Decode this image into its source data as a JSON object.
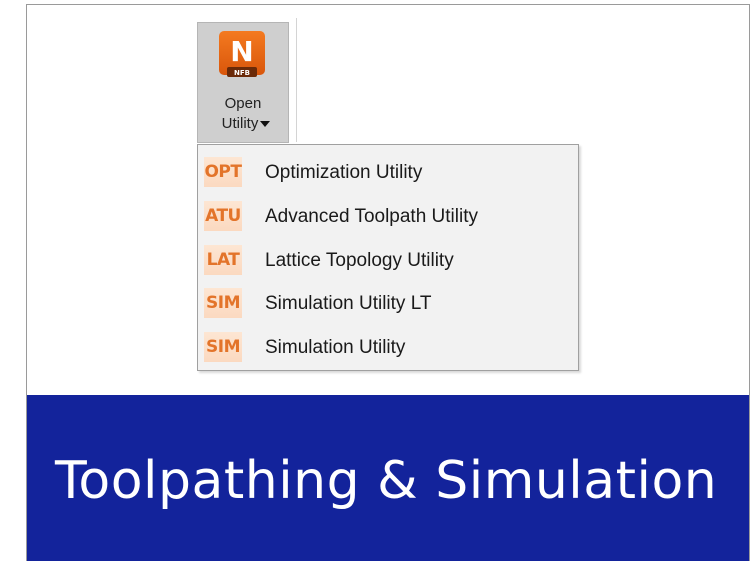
{
  "ribbon": {
    "button": {
      "icon_letter": "N",
      "icon_sub": "NFB",
      "icon_color": "#e8660f",
      "label_line1": "Open",
      "label_line2": "Utility"
    }
  },
  "menu": {
    "items": [
      {
        "tag": "OPT",
        "label": "Optimization Utility"
      },
      {
        "tag": "ATU",
        "label": "Advanced Toolpath Utility"
      },
      {
        "tag": "LAT",
        "label": "Lattice Topology Utility"
      },
      {
        "tag": "SIM",
        "label": "Simulation Utility LT"
      },
      {
        "tag": "SIM",
        "label": "Simulation Utility"
      }
    ]
  },
  "banner": {
    "title": "Toolpathing & Simulation",
    "background": "#13239b"
  }
}
